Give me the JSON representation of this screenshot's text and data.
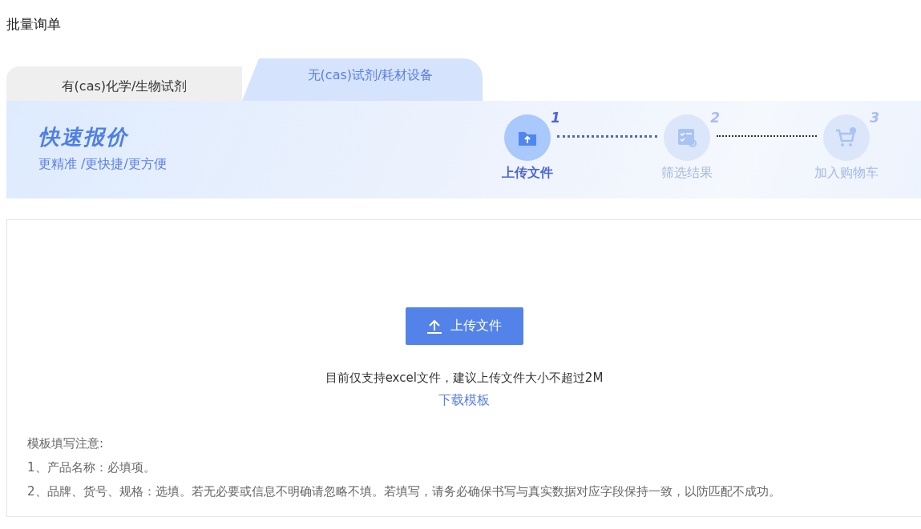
{
  "page_title": "批量询单",
  "tabs": [
    {
      "label": "有(cas)化学/生物试剂",
      "selected": false
    },
    {
      "label": "无(cas)试剂/耗材设备",
      "selected": true
    }
  ],
  "banner": {
    "title": "快速报价",
    "subtitle": "更精准 /更快捷/更方便"
  },
  "steps": [
    {
      "number": "1",
      "label": "上传文件",
      "active": true,
      "kind": "upload"
    },
    {
      "number": "2",
      "label": "筛选结果",
      "active": false,
      "kind": "filter"
    },
    {
      "number": "3",
      "label": "加入购物车",
      "active": false,
      "kind": "cart"
    }
  ],
  "upload": {
    "button": "上传文件",
    "hint": "目前仅支持excel文件，建议上传文件大小不超过2M",
    "template_link": "下载模板"
  },
  "notes": {
    "title": "模板填写注意:",
    "items": [
      "1、产品名称：必填项。",
      "2、品牌、货号、规格：选填。若无必要或信息不明确请忽略不填。若填写，请务必确保书写与真实数据对应字段保持一致，以防匹配不成功。"
    ]
  }
}
